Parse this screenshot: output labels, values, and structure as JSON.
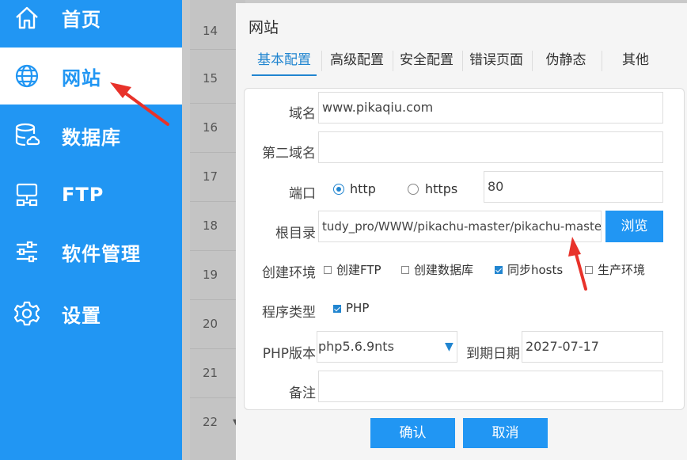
{
  "sidebar": {
    "items": [
      {
        "label": "首页",
        "icon": "home-icon"
      },
      {
        "label": "网站",
        "icon": "globe-icon",
        "active": true
      },
      {
        "label": "数据库",
        "icon": "database-icon"
      },
      {
        "label": "FTP",
        "icon": "ftp-icon"
      },
      {
        "label": "软件管理",
        "icon": "sliders-icon"
      },
      {
        "label": "设置",
        "icon": "gear-icon"
      }
    ]
  },
  "background_list": {
    "rows": [
      "14",
      "15",
      "16",
      "17",
      "18",
      "19",
      "20",
      "21",
      "22"
    ]
  },
  "dialog": {
    "title": "网站",
    "tabs": [
      "基本配置",
      "高级配置",
      "安全配置",
      "错误页面",
      "伪静态",
      "其他"
    ],
    "active_tab": "基本配置",
    "form": {
      "domain_label": "域名",
      "domain_value": "www.pikaqiu.com",
      "second_domain_label": "第二域名",
      "second_domain_value": "",
      "port_label": "端口",
      "protocol_http": "http",
      "protocol_https": "https",
      "protocol_selected": "http",
      "port_value": "80",
      "root_label": "根目录",
      "root_value": "tudy_pro/WWW/pikachu-master/pikachu-master",
      "browse_label": "浏览",
      "env_label": "创建环境",
      "env_options": [
        {
          "label": "创建FTP",
          "checked": false
        },
        {
          "label": "创建数据库",
          "checked": false
        },
        {
          "label": "同步hosts",
          "checked": true
        },
        {
          "label": "生产环境",
          "checked": false
        }
      ],
      "program_type_label": "程序类型",
      "program_type_option": "PHP",
      "program_type_checked": true,
      "php_version_label": "PHP版本",
      "php_version_value": "php5.6.9nts",
      "expiry_label": "到期日期",
      "expiry_value": "2027-07-17",
      "note_label": "备注",
      "note_value": ""
    },
    "buttons": {
      "confirm": "确认",
      "cancel": "取消"
    }
  },
  "colors": {
    "sidebar_bg": "#2196f3",
    "accent": "#2185d0",
    "annotation_arrow": "#e8322a"
  }
}
